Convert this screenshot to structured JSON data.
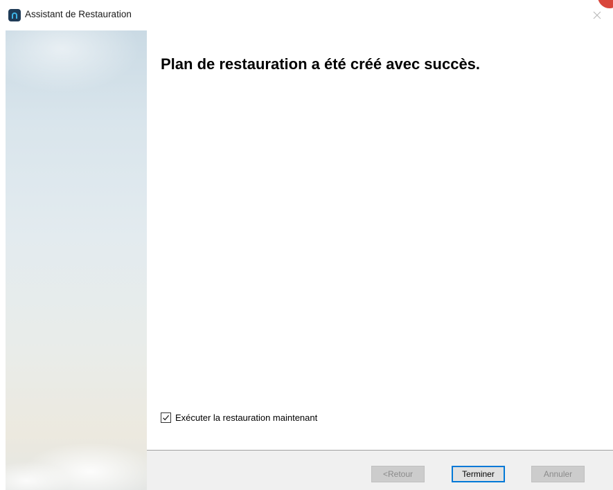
{
  "window": {
    "title": "Assistant de Restauration",
    "icon": "app-logo-icon",
    "close_icon": "close-icon"
  },
  "main": {
    "heading": "Plan de restauration a été créé avec succès."
  },
  "options": {
    "run_now_label": "Exécuter la restauration maintenant",
    "run_now_checked": true
  },
  "footer": {
    "back_label": "<Retour",
    "finish_label": "Terminer",
    "cancel_label": "Annuler"
  },
  "colors": {
    "accent": "#0078d7",
    "footer_bg": "#f0f0f0",
    "badge": "#d9473c"
  }
}
